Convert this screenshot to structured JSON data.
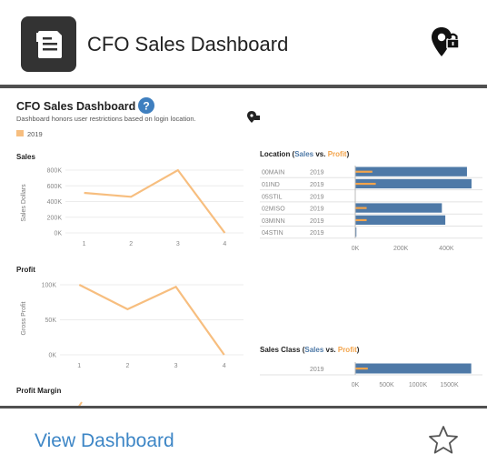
{
  "card": {
    "title": "CFO Sales Dashboard",
    "app_icon": "document-icon",
    "status_icon": "location-lock-icon",
    "footer_link": "View Dashboard",
    "favorite_icon": "star-outline-icon"
  },
  "colors": {
    "orange": "#f7be7f",
    "blue": "#4e79a7",
    "link": "#3d86c6",
    "icon_bg": "#333333"
  },
  "thumbnail": {
    "title": "CFO Sales Dashboard",
    "subtitle": "Dashboard honors user restrictions based on login location.",
    "legend_year": "2019",
    "location_header": {
      "prefix": "Location (",
      "sales": "Sales",
      "vs": " vs. ",
      "profit": "Profit",
      "suffix": ")"
    },
    "salesclass_header": {
      "prefix": "Sales Class (",
      "sales": "Sales",
      "vs": " vs. ",
      "profit": "Profit",
      "suffix": ")"
    },
    "profit_margin_title": "Profit Margin"
  },
  "chart_data": [
    {
      "type": "line",
      "title": "Sales",
      "ylabel": "Sales Dollars",
      "x": [
        1,
        2,
        3,
        4
      ],
      "values": [
        510000,
        460000,
        800000,
        0
      ],
      "ylim": [
        0,
        800000
      ],
      "yticks": [
        "800K",
        "600K",
        "400K",
        "200K",
        "0K"
      ],
      "xticks": [
        "1",
        "2",
        "3",
        "4"
      ]
    },
    {
      "type": "line",
      "title": "Profit",
      "ylabel": "Gross Profit",
      "x": [
        1,
        2,
        3,
        4
      ],
      "values": [
        100000,
        65000,
        97000,
        0
      ],
      "ylim": [
        0,
        100000
      ],
      "yticks": [
        "100K",
        "50K",
        "0K"
      ],
      "xticks": [
        "1",
        "2",
        "3",
        "4"
      ]
    },
    {
      "type": "bar",
      "title": "Location (Sales vs. Profit)",
      "categories": [
        "00MAIN",
        "01IND",
        "05STIL",
        "02MISO",
        "03MINN",
        "04STIN"
      ],
      "year": "2019",
      "series": [
        {
          "name": "Sales",
          "values": [
            490000,
            510000,
            0,
            380000,
            395000,
            5000
          ]
        },
        {
          "name": "Profit",
          "values": [
            75000,
            90000,
            0,
            50000,
            50000,
            0
          ]
        }
      ],
      "xlim": [
        0,
        550000
      ],
      "xticks": [
        "0K",
        "200K",
        "400K"
      ]
    },
    {
      "type": "bar",
      "title": "Sales Class (Sales vs. Profit)",
      "categories": [
        "2019"
      ],
      "series": [
        {
          "name": "Sales",
          "values": [
            1850000
          ]
        },
        {
          "name": "Profit",
          "values": [
            200000
          ]
        }
      ],
      "xlim": [
        0,
        2000000
      ],
      "xticks": [
        "0K",
        "500K",
        "1000K",
        "1500K"
      ]
    }
  ]
}
